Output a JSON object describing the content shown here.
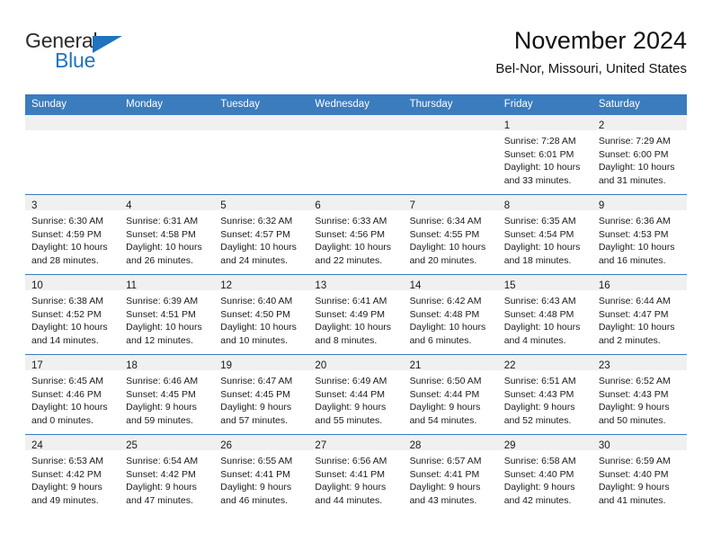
{
  "brand": {
    "name_part1": "General",
    "name_part2": "Blue",
    "accent_color": "#1f74bd"
  },
  "header": {
    "title": "November 2024",
    "location": "Bel-Nor, Missouri, United States"
  },
  "calendar": {
    "header_color": "#3a7cbe",
    "weekdays": [
      "Sunday",
      "Monday",
      "Tuesday",
      "Wednesday",
      "Thursday",
      "Friday",
      "Saturday"
    ],
    "weeks": [
      [
        {
          "day": "",
          "sunrise": "",
          "sunset": "",
          "daylight": "",
          "daylight2": "",
          "empty": true
        },
        {
          "day": "",
          "sunrise": "",
          "sunset": "",
          "daylight": "",
          "daylight2": "",
          "empty": true
        },
        {
          "day": "",
          "sunrise": "",
          "sunset": "",
          "daylight": "",
          "daylight2": "",
          "empty": true
        },
        {
          "day": "",
          "sunrise": "",
          "sunset": "",
          "daylight": "",
          "daylight2": "",
          "empty": true
        },
        {
          "day": "",
          "sunrise": "",
          "sunset": "",
          "daylight": "",
          "daylight2": "",
          "empty": true
        },
        {
          "day": "1",
          "sunrise": "Sunrise: 7:28 AM",
          "sunset": "Sunset: 6:01 PM",
          "daylight": "Daylight: 10 hours",
          "daylight2": "and 33 minutes.",
          "empty": false
        },
        {
          "day": "2",
          "sunrise": "Sunrise: 7:29 AM",
          "sunset": "Sunset: 6:00 PM",
          "daylight": "Daylight: 10 hours",
          "daylight2": "and 31 minutes.",
          "empty": false
        }
      ],
      [
        {
          "day": "3",
          "sunrise": "Sunrise: 6:30 AM",
          "sunset": "Sunset: 4:59 PM",
          "daylight": "Daylight: 10 hours",
          "daylight2": "and 28 minutes.",
          "empty": false
        },
        {
          "day": "4",
          "sunrise": "Sunrise: 6:31 AM",
          "sunset": "Sunset: 4:58 PM",
          "daylight": "Daylight: 10 hours",
          "daylight2": "and 26 minutes.",
          "empty": false
        },
        {
          "day": "5",
          "sunrise": "Sunrise: 6:32 AM",
          "sunset": "Sunset: 4:57 PM",
          "daylight": "Daylight: 10 hours",
          "daylight2": "and 24 minutes.",
          "empty": false
        },
        {
          "day": "6",
          "sunrise": "Sunrise: 6:33 AM",
          "sunset": "Sunset: 4:56 PM",
          "daylight": "Daylight: 10 hours",
          "daylight2": "and 22 minutes.",
          "empty": false
        },
        {
          "day": "7",
          "sunrise": "Sunrise: 6:34 AM",
          "sunset": "Sunset: 4:55 PM",
          "daylight": "Daylight: 10 hours",
          "daylight2": "and 20 minutes.",
          "empty": false
        },
        {
          "day": "8",
          "sunrise": "Sunrise: 6:35 AM",
          "sunset": "Sunset: 4:54 PM",
          "daylight": "Daylight: 10 hours",
          "daylight2": "and 18 minutes.",
          "empty": false
        },
        {
          "day": "9",
          "sunrise": "Sunrise: 6:36 AM",
          "sunset": "Sunset: 4:53 PM",
          "daylight": "Daylight: 10 hours",
          "daylight2": "and 16 minutes.",
          "empty": false
        }
      ],
      [
        {
          "day": "10",
          "sunrise": "Sunrise: 6:38 AM",
          "sunset": "Sunset: 4:52 PM",
          "daylight": "Daylight: 10 hours",
          "daylight2": "and 14 minutes.",
          "empty": false
        },
        {
          "day": "11",
          "sunrise": "Sunrise: 6:39 AM",
          "sunset": "Sunset: 4:51 PM",
          "daylight": "Daylight: 10 hours",
          "daylight2": "and 12 minutes.",
          "empty": false
        },
        {
          "day": "12",
          "sunrise": "Sunrise: 6:40 AM",
          "sunset": "Sunset: 4:50 PM",
          "daylight": "Daylight: 10 hours",
          "daylight2": "and 10 minutes.",
          "empty": false
        },
        {
          "day": "13",
          "sunrise": "Sunrise: 6:41 AM",
          "sunset": "Sunset: 4:49 PM",
          "daylight": "Daylight: 10 hours",
          "daylight2": "and 8 minutes.",
          "empty": false
        },
        {
          "day": "14",
          "sunrise": "Sunrise: 6:42 AM",
          "sunset": "Sunset: 4:48 PM",
          "daylight": "Daylight: 10 hours",
          "daylight2": "and 6 minutes.",
          "empty": false
        },
        {
          "day": "15",
          "sunrise": "Sunrise: 6:43 AM",
          "sunset": "Sunset: 4:48 PM",
          "daylight": "Daylight: 10 hours",
          "daylight2": "and 4 minutes.",
          "empty": false
        },
        {
          "day": "16",
          "sunrise": "Sunrise: 6:44 AM",
          "sunset": "Sunset: 4:47 PM",
          "daylight": "Daylight: 10 hours",
          "daylight2": "and 2 minutes.",
          "empty": false
        }
      ],
      [
        {
          "day": "17",
          "sunrise": "Sunrise: 6:45 AM",
          "sunset": "Sunset: 4:46 PM",
          "daylight": "Daylight: 10 hours",
          "daylight2": "and 0 minutes.",
          "empty": false
        },
        {
          "day": "18",
          "sunrise": "Sunrise: 6:46 AM",
          "sunset": "Sunset: 4:45 PM",
          "daylight": "Daylight: 9 hours",
          "daylight2": "and 59 minutes.",
          "empty": false
        },
        {
          "day": "19",
          "sunrise": "Sunrise: 6:47 AM",
          "sunset": "Sunset: 4:45 PM",
          "daylight": "Daylight: 9 hours",
          "daylight2": "and 57 minutes.",
          "empty": false
        },
        {
          "day": "20",
          "sunrise": "Sunrise: 6:49 AM",
          "sunset": "Sunset: 4:44 PM",
          "daylight": "Daylight: 9 hours",
          "daylight2": "and 55 minutes.",
          "empty": false
        },
        {
          "day": "21",
          "sunrise": "Sunrise: 6:50 AM",
          "sunset": "Sunset: 4:44 PM",
          "daylight": "Daylight: 9 hours",
          "daylight2": "and 54 minutes.",
          "empty": false
        },
        {
          "day": "22",
          "sunrise": "Sunrise: 6:51 AM",
          "sunset": "Sunset: 4:43 PM",
          "daylight": "Daylight: 9 hours",
          "daylight2": "and 52 minutes.",
          "empty": false
        },
        {
          "day": "23",
          "sunrise": "Sunrise: 6:52 AM",
          "sunset": "Sunset: 4:43 PM",
          "daylight": "Daylight: 9 hours",
          "daylight2": "and 50 minutes.",
          "empty": false
        }
      ],
      [
        {
          "day": "24",
          "sunrise": "Sunrise: 6:53 AM",
          "sunset": "Sunset: 4:42 PM",
          "daylight": "Daylight: 9 hours",
          "daylight2": "and 49 minutes.",
          "empty": false
        },
        {
          "day": "25",
          "sunrise": "Sunrise: 6:54 AM",
          "sunset": "Sunset: 4:42 PM",
          "daylight": "Daylight: 9 hours",
          "daylight2": "and 47 minutes.",
          "empty": false
        },
        {
          "day": "26",
          "sunrise": "Sunrise: 6:55 AM",
          "sunset": "Sunset: 4:41 PM",
          "daylight": "Daylight: 9 hours",
          "daylight2": "and 46 minutes.",
          "empty": false
        },
        {
          "day": "27",
          "sunrise": "Sunrise: 6:56 AM",
          "sunset": "Sunset: 4:41 PM",
          "daylight": "Daylight: 9 hours",
          "daylight2": "and 44 minutes.",
          "empty": false
        },
        {
          "day": "28",
          "sunrise": "Sunrise: 6:57 AM",
          "sunset": "Sunset: 4:41 PM",
          "daylight": "Daylight: 9 hours",
          "daylight2": "and 43 minutes.",
          "empty": false
        },
        {
          "day": "29",
          "sunrise": "Sunrise: 6:58 AM",
          "sunset": "Sunset: 4:40 PM",
          "daylight": "Daylight: 9 hours",
          "daylight2": "and 42 minutes.",
          "empty": false
        },
        {
          "day": "30",
          "sunrise": "Sunrise: 6:59 AM",
          "sunset": "Sunset: 4:40 PM",
          "daylight": "Daylight: 9 hours",
          "daylight2": "and 41 minutes.",
          "empty": false
        }
      ]
    ]
  }
}
